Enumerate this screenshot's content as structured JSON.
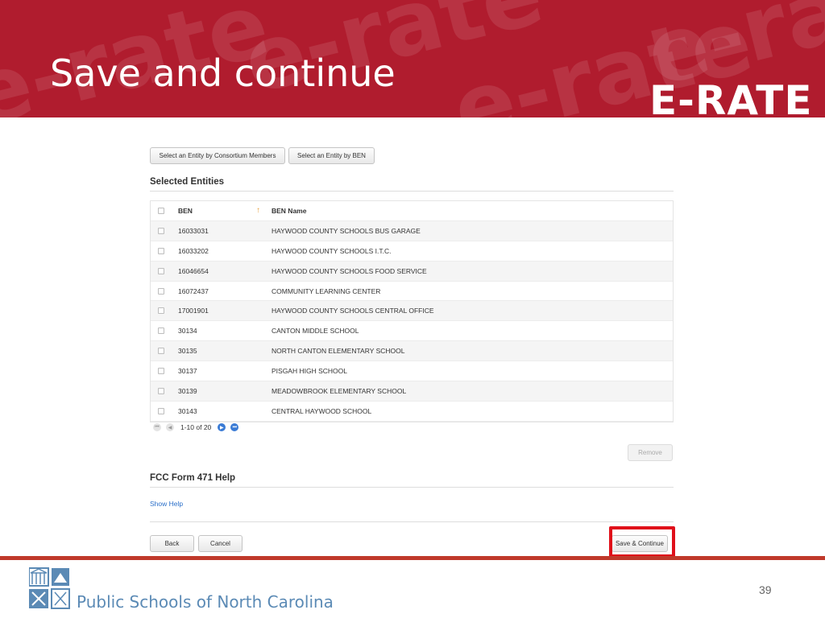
{
  "slide": {
    "title": "Save and continue",
    "brand": "E-RATE",
    "watermark": "e-rate",
    "page_number": "39",
    "organization": "Public Schools of North Carolina",
    "accent_color": "#b01c2e"
  },
  "toolbar": {
    "consortium_button": "Select an Entity by Consortium Members",
    "ben_button": "Select an Entity by BEN"
  },
  "selected_entities": {
    "title": "Selected Entities",
    "columns": [
      "BEN",
      "BEN Name"
    ],
    "rows": [
      {
        "ben": "16033031",
        "name": "HAYWOOD COUNTY SCHOOLS BUS GARAGE"
      },
      {
        "ben": "16033202",
        "name": "HAYWOOD COUNTY SCHOOLS I.T.C."
      },
      {
        "ben": "16046654",
        "name": "HAYWOOD COUNTY SCHOOLS FOOD SERVICE"
      },
      {
        "ben": "16072437",
        "name": "COMMUNITY LEARNING CENTER"
      },
      {
        "ben": "17001901",
        "name": "HAYWOOD COUNTY SCHOOLS CENTRAL OFFICE"
      },
      {
        "ben": "30134",
        "name": "CANTON MIDDLE SCHOOL"
      },
      {
        "ben": "30135",
        "name": "NORTH CANTON ELEMENTARY SCHOOL"
      },
      {
        "ben": "30137",
        "name": "PISGAH HIGH SCHOOL"
      },
      {
        "ben": "30139",
        "name": "MEADOWBROOK ELEMENTARY SCHOOL"
      },
      {
        "ben": "30143",
        "name": "CENTRAL HAYWOOD SCHOOL"
      }
    ],
    "pager_label": "1-10 of 20",
    "remove_button": "Remove"
  },
  "help": {
    "title": "FCC Form 471 Help",
    "show_link": "Show Help"
  },
  "actions": {
    "back": "Back",
    "cancel": "Cancel",
    "save_continue": "Save & Continue"
  }
}
